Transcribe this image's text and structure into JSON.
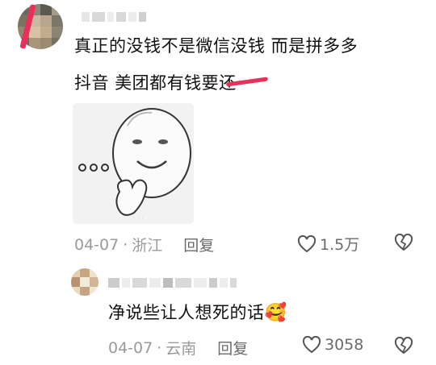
{
  "comment": {
    "line1": "真正的没钱不是微信没钱 而是拼多多",
    "line2": "抖音 美团都有钱要还",
    "date": "04-07",
    "location": "浙江",
    "separator": "·",
    "reply_label": "回复",
    "like_count": "1.5万",
    "like_icon": "heart-outline-icon",
    "dislike_icon": "broken-heart-icon"
  },
  "reply": {
    "text": "净说些让人想死的话",
    "emoji": "🥰",
    "date": "04-07",
    "location": "云南",
    "separator": "·",
    "reply_label": "回复",
    "like_count": "3058",
    "like_icon": "heart-outline-icon",
    "dislike_icon": "broken-heart-icon"
  },
  "colors": {
    "text": "#111111",
    "meta": "#9a9a9a",
    "action": "#6b6b6b",
    "red_mark": "#e8305a"
  }
}
